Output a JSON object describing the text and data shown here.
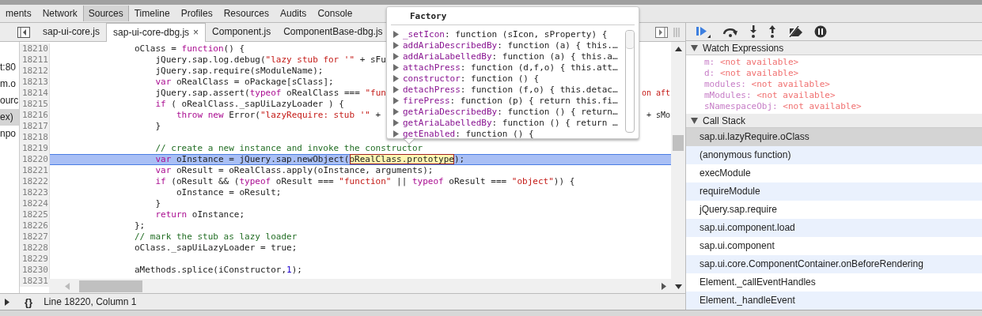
{
  "panel_tabs": [
    {
      "label": "ments",
      "selected": false
    },
    {
      "label": "Network",
      "selected": false
    },
    {
      "label": "Sources",
      "selected": true
    },
    {
      "label": "Timeline",
      "selected": false
    },
    {
      "label": "Profiles",
      "selected": false
    },
    {
      "label": "Resources",
      "selected": false
    },
    {
      "label": "Audits",
      "selected": false
    },
    {
      "label": "Console",
      "selected": false
    }
  ],
  "file_tabs": [
    {
      "label": "sap-ui-core.js",
      "selected": false
    },
    {
      "label": "sap-ui-core-dbg.js",
      "selected": true,
      "close": "×"
    },
    {
      "label": "Component.js",
      "selected": false
    },
    {
      "label": "ComponentBase-dbg.js",
      "selected": false
    }
  ],
  "navigator": [
    {
      "label": "t:80",
      "selected": false
    },
    {
      "label": "m.o",
      "selected": false
    },
    {
      "label": "ourc",
      "selected": false
    },
    {
      "label": "ex)",
      "selected": true
    },
    {
      "label": "npo",
      "selected": false
    }
  ],
  "code_lines": [
    {
      "number": "18210",
      "selected": false,
      "segments": [
        {
          "kind": "plain",
          "text": "                oClass = "
        },
        {
          "kind": "keyword",
          "text": "function"
        },
        {
          "kind": "plain",
          "text": "() {"
        }
      ]
    },
    {
      "number": "18211",
      "selected": false,
      "segments": [
        {
          "kind": "plain",
          "text": "                    jQuery.sap.log.debug("
        },
        {
          "kind": "string",
          "text": "\"lazy stub for '\""
        },
        {
          "kind": "plain",
          "text": " + sFu"
        }
      ]
    },
    {
      "number": "18212",
      "selected": false,
      "segments": [
        {
          "kind": "plain",
          "text": "                    jQuery.sap.require(sModuleName);"
        }
      ]
    },
    {
      "number": "18213",
      "selected": false,
      "segments": [
        {
          "kind": "keyword",
          "text": "                    var"
        },
        {
          "kind": "plain",
          "text": " oRealClass = oPackage[sClass];"
        }
      ]
    },
    {
      "number": "18214",
      "selected": false,
      "segments": [
        {
          "kind": "plain",
          "text": "                    jQuery.sap.assert("
        },
        {
          "kind": "keyword",
          "text": "typeof"
        },
        {
          "kind": "plain",
          "text": " oRealClass === "
        },
        {
          "kind": "string",
          "text": "\"fun"
        }
      ],
      "tail": {
        "kind": "string",
        "text": "on aft"
      }
    },
    {
      "number": "18215",
      "selected": false,
      "segments": [
        {
          "kind": "keyword",
          "text": "                    if"
        },
        {
          "kind": "plain",
          "text": " ( oRealClass._sapUiLazyLoader ) {"
        }
      ]
    },
    {
      "number": "18216",
      "selected": false,
      "segments": [
        {
          "kind": "keyword",
          "text": "                        throw new"
        },
        {
          "kind": "plain",
          "text": " Error("
        },
        {
          "kind": "string",
          "text": "\"lazyRequire: stub '\""
        },
        {
          "kind": "plain",
          "text": " +"
        }
      ],
      "tail": {
        "kind": "plain",
        "text": "+ sMo"
      }
    },
    {
      "number": "18217",
      "selected": false,
      "segments": [
        {
          "kind": "plain",
          "text": "                    }"
        }
      ]
    },
    {
      "number": "18218",
      "selected": false
    },
    {
      "number": "18219",
      "selected": false,
      "segments": [
        {
          "kind": "comment",
          "text": "                    // create a new instance and invoke the constructor"
        }
      ]
    },
    {
      "number": "18220",
      "selected": true,
      "segments": [
        {
          "kind": "keyword",
          "text": "                    var"
        },
        {
          "kind": "plain",
          "text": " oInstance = jQuery.sap.newObject("
        },
        {
          "kind": "highlight",
          "text": "oRealClass.prototype"
        },
        {
          "kind": "plain",
          "text": ");"
        }
      ]
    },
    {
      "number": "18221",
      "selected": false,
      "segments": [
        {
          "kind": "keyword",
          "text": "                    var"
        },
        {
          "kind": "plain",
          "text": " oResult = oRealClass.apply(oInstance, arguments);"
        }
      ]
    },
    {
      "number": "18222",
      "selected": false,
      "segments": [
        {
          "kind": "keyword",
          "text": "                    if"
        },
        {
          "kind": "plain",
          "text": " (oResult && ("
        },
        {
          "kind": "keyword",
          "text": "typeof"
        },
        {
          "kind": "plain",
          "text": " oResult === "
        },
        {
          "kind": "string",
          "text": "\"function\""
        },
        {
          "kind": "plain",
          "text": " || "
        },
        {
          "kind": "keyword",
          "text": "typeof"
        },
        {
          "kind": "plain",
          "text": " oResult === "
        },
        {
          "kind": "string",
          "text": "\"object\""
        },
        {
          "kind": "plain",
          "text": ")) {"
        }
      ]
    },
    {
      "number": "18223",
      "selected": false,
      "segments": [
        {
          "kind": "plain",
          "text": "                        oInstance = oResult;"
        }
      ]
    },
    {
      "number": "18224",
      "selected": false,
      "segments": [
        {
          "kind": "plain",
          "text": "                    }"
        }
      ]
    },
    {
      "number": "18225",
      "selected": false,
      "segments": [
        {
          "kind": "keyword",
          "text": "                    return"
        },
        {
          "kind": "plain",
          "text": " oInstance;"
        }
      ]
    },
    {
      "number": "18226",
      "selected": false,
      "segments": [
        {
          "kind": "plain",
          "text": "                };"
        }
      ]
    },
    {
      "number": "18227",
      "selected": false,
      "segments": [
        {
          "kind": "comment",
          "text": "                // mark the stub as lazy loader"
        }
      ]
    },
    {
      "number": "18228",
      "selected": false,
      "segments": [
        {
          "kind": "plain",
          "text": "                oClass._sapUiLazyLoader = true;"
        }
      ]
    },
    {
      "number": "18229",
      "selected": false
    },
    {
      "number": "18230",
      "selected": false,
      "segments": [
        {
          "kind": "plain",
          "text": "                aMethods.splice(iConstructor,"
        },
        {
          "kind": "number",
          "text": "1"
        },
        {
          "kind": "plain",
          "text": ");"
        }
      ]
    },
    {
      "number": "18231",
      "selected": false
    }
  ],
  "status_bar": {
    "pretty_print": "{}",
    "position": "Line 18220, Column 1"
  },
  "popover": {
    "title": "Factory",
    "properties": [
      {
        "name": "_setIcon",
        "value": ": function (sIcon, sProperty) {"
      },
      {
        "name": "addAriaDescribedBy",
        "value": ": function (a) { this.…"
      },
      {
        "name": "addAriaLabelledBy",
        "value": ": function (a) { this.a…"
      },
      {
        "name": "attachPress",
        "value": ": function (d,f,o) { this.att…"
      },
      {
        "name": "constructor",
        "value": ": function () {"
      },
      {
        "name": "detachPress",
        "value": ": function (f,o) { this.detac…"
      },
      {
        "name": "firePress",
        "value": ": function (p) { return this.fi…"
      },
      {
        "name": "getAriaDescribedBy",
        "value": ": function () { return…"
      },
      {
        "name": "getAriaLabelledBy",
        "value": ": function () { return …"
      },
      {
        "name": "getEnabled",
        "value": ": function () {"
      }
    ]
  },
  "watch_expressions": {
    "title": "Watch Expressions",
    "expanded": true,
    "items": [
      {
        "name": "m:",
        "value": "<not available>"
      },
      {
        "name": "d:",
        "value": "<not available>"
      },
      {
        "name": "modules:",
        "value": "<not available>"
      },
      {
        "name": "mModules:",
        "value": "<not available>"
      },
      {
        "name": "sNamespaceObj:",
        "value": "<not available>"
      }
    ]
  },
  "call_stack": {
    "title": "Call Stack",
    "expanded": true,
    "frames": [
      {
        "label": "sap.ui.lazyRequire.oClass",
        "selected": true
      },
      {
        "label": "(anonymous function)",
        "selected": false
      },
      {
        "label": "execModule",
        "selected": false
      },
      {
        "label": "requireModule",
        "selected": false
      },
      {
        "label": "jQuery.sap.require",
        "selected": false
      },
      {
        "label": "sap.ui.component.load",
        "selected": false
      },
      {
        "label": "sap.ui.component",
        "selected": false
      },
      {
        "label": "sap.ui.core.ComponentContainer.onBeforeRendering",
        "selected": false
      },
      {
        "label": "Element._callEventHandles",
        "selected": false
      },
      {
        "label": "Element._handleEvent",
        "selected": false
      }
    ]
  }
}
